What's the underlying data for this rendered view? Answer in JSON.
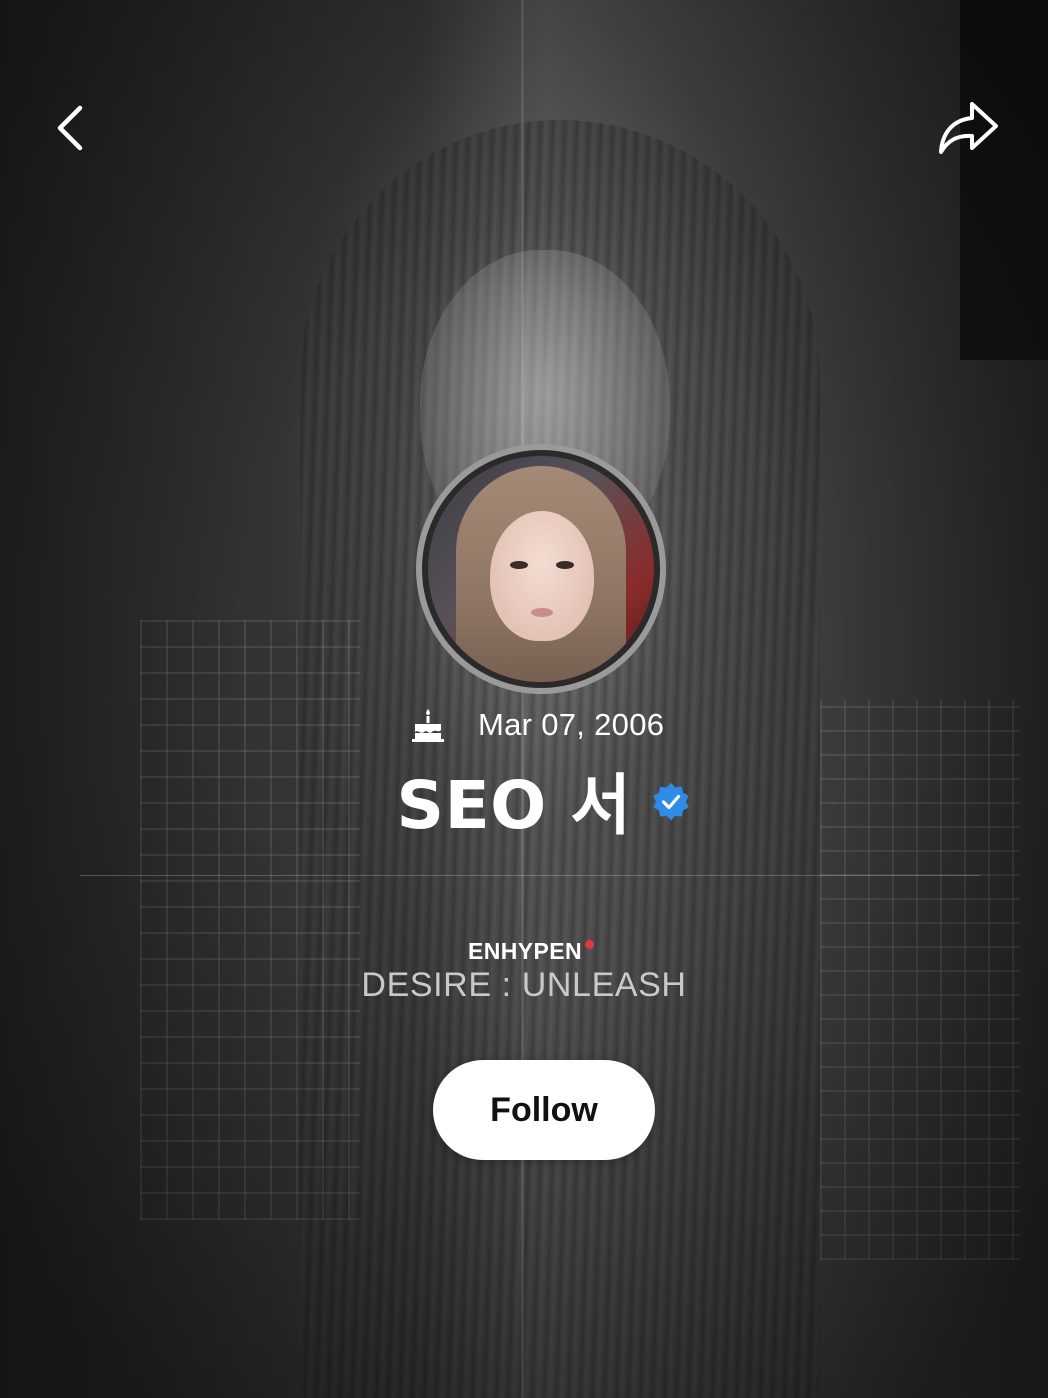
{
  "nav": {
    "back_icon": "chevron-left-icon",
    "share_icon": "share-arrow-icon"
  },
  "profile": {
    "avatar_alt": "profile photo",
    "birthday_icon": "cake-icon",
    "birthday": "Mar 07, 2006",
    "name": "SEO 서",
    "verified_icon": "verified-badge-icon",
    "group": "ENHYPEN",
    "album": "DESIRE : UNLEASH",
    "follow_label": "Follow"
  },
  "colors": {
    "verified": "#2f8be6",
    "live_dot": "#e0393e",
    "follow_bg": "#ffffff",
    "album_text": "#c9c9c9"
  }
}
